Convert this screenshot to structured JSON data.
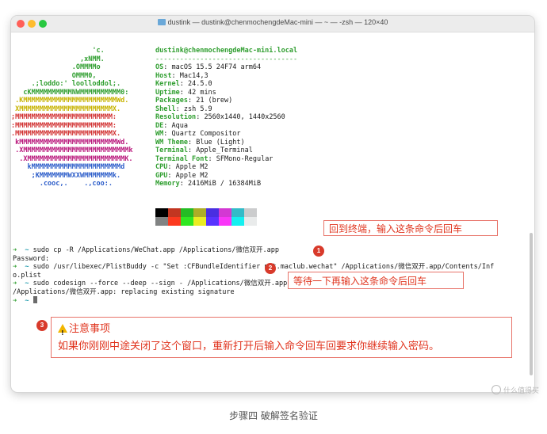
{
  "window": {
    "title": "dustink — dustink@chenmochengdeMac-mini — ~ — -zsh — 120×40"
  },
  "logo_lines": [
    "                    'c.",
    "                 ,xNMM.",
    "               .OMMMMo",
    "               OMMM0,",
    "     .;loddo:' loolloddol;.",
    "   cKMMMMMMMMMMNWMMMMMMMMMM0:",
    " .KMMMMMMMMMMMMMMMMMMMMMMMWd.",
    " XMMMMMMMMMMMMMMMMMMMMMMMX.",
    ";MMMMMMMMMMMMMMMMMMMMMMMM:",
    ":MMMMMMMMMMMMMMMMMMMMMMMM:",
    ".MMMMMMMMMMMMMMMMMMMMMMMMX.",
    " kMMMMMMMMMMMMMMMMMMMMMMMMWd.",
    " .XMMMMMMMMMMMMMMMMMMMMMMMMMMk",
    "  .XMMMMMMMMMMMMMMMMMMMMMMMMK.",
    "    kMMMMMMMMMMMMMMMMMMMMMMd",
    "     ;KMMMMMMMWXXWMMMMMMMk.",
    "       .cooc,.    .,coo:."
  ],
  "logo_colors": [
    "#2f9e2f",
    "#2f9e2f",
    "#2f9e2f",
    "#2f9e2f",
    "#2f9e2f",
    "#2f9e2f",
    "#c7b300",
    "#c7b300",
    "#d13030",
    "#d13030",
    "#d13030",
    "#b8157a",
    "#b8157a",
    "#b8157a",
    "#2b5cc9",
    "#2b5cc9",
    "#2b5cc9"
  ],
  "sysinfo": {
    "header": "dustink@chenmochengdeMac-mini.local",
    "rule": "-----------------------------------",
    "rows": [
      {
        "key": "OS",
        "value": "macOS 15.5 24F74 arm64"
      },
      {
        "key": "Host",
        "value": "Mac14,3"
      },
      {
        "key": "Kernel",
        "value": "24.5.0"
      },
      {
        "key": "Uptime",
        "value": "42 mins"
      },
      {
        "key": "Packages",
        "value": "21 (brew)"
      },
      {
        "key": "Shell",
        "value": "zsh 5.9"
      },
      {
        "key": "Resolution",
        "value": "2560x1440, 1440x2560"
      },
      {
        "key": "DE",
        "value": "Aqua"
      },
      {
        "key": "WM",
        "value": "Quartz Compositor"
      },
      {
        "key": "WM Theme",
        "value": "Blue (Light)"
      },
      {
        "key": "Terminal",
        "value": "Apple_Terminal"
      },
      {
        "key": "Terminal Font",
        "value": "SFMono-Regular"
      },
      {
        "key": "CPU",
        "value": "Apple M2"
      },
      {
        "key": "GPU",
        "value": "Apple M2"
      },
      {
        "key": "Memory",
        "value": "2416MiB / 16384MiB"
      }
    ]
  },
  "swatch_colors": {
    "top": [
      "#000000",
      "#c23621",
      "#25bc24",
      "#adad27",
      "#492ee1",
      "#d338d3",
      "#33bbc8",
      "#cbcccd"
    ],
    "bottom": [
      "#818383",
      "#fc391f",
      "#31e722",
      "#eaec23",
      "#5833ff",
      "#f935f8",
      "#14f0f0",
      "#e9ebeb"
    ]
  },
  "commands": {
    "prompt_arrow": "➜",
    "prompt_tilde": "~",
    "cmd1": "sudo cp -R /Applications/WeChat.app /Applications/微信双开.app",
    "password": "Password:",
    "cmd2": "sudo /usr/libexec/PlistBuddy -c \"Set :CFBundleIdentifier net.maclub.wechat\" /Applications/微信双开.app/Contents/Inf",
    "cmd2_wrap": "o.plist",
    "cmd3": "sudo codesign --force --deep --sign - /Applications/微信双开.app",
    "output": "/Applications/微信双开.app: replacing existing signature"
  },
  "annotations": {
    "note1": "回到终端，输入这条命令后回车",
    "note2": "等待一下再输入这条命令后回车",
    "note3_title": "注意事项",
    "note3_body": "如果你刚刚中途关闭了这个窗口，重新打开后输入命令回车回要求你继续输入密码。",
    "badge1": "1",
    "badge2": "2",
    "badge3": "3"
  },
  "caption": "步骤四 破解签名验证",
  "watermark": "什么值得买"
}
